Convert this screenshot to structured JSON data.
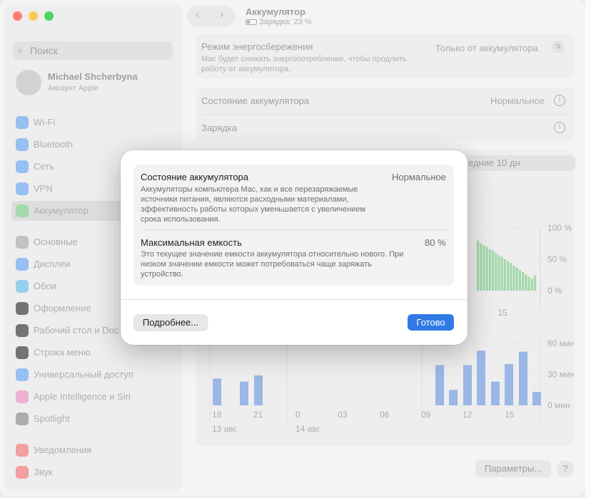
{
  "colors": {
    "accent": "#2f7ae5",
    "bar_green": "#8fd19a",
    "bar_blue": "#86a8e0",
    "traffic_red": "#ff5f57",
    "traffic_yellow": "#febc2e",
    "traffic_green": "#28c840"
  },
  "sidebar": {
    "search_placeholder": "Поиск",
    "account": {
      "name": "Michael Shcherbyna",
      "sub": "Аккаунт Apple"
    },
    "items": [
      {
        "label": "Wi-Fi",
        "icon": "wifi-icon",
        "color": "#7fb2f0"
      },
      {
        "label": "Bluetooth",
        "icon": "bluetooth-icon",
        "color": "#7fb2f0"
      },
      {
        "label": "Сеть",
        "icon": "globe-icon",
        "color": "#7fb2f0"
      },
      {
        "label": "VPN",
        "icon": "vpn-icon",
        "color": "#7fb2f0"
      },
      {
        "label": "Аккумулятор",
        "icon": "battery-icon",
        "color": "#8fd19a"
      },
      {
        "label": "Основные",
        "icon": "gear-icon",
        "color": "#b5b5b5"
      },
      {
        "label": "Дисплеи",
        "icon": "display-icon",
        "color": "#7fb2f0"
      },
      {
        "label": "Обои",
        "icon": "wallpaper-icon",
        "color": "#7fc6e8"
      },
      {
        "label": "Оформление",
        "icon": "appearance-icon",
        "color": "#555555"
      },
      {
        "label": "Рабочий стол и Doc",
        "icon": "desktop-dock-icon",
        "color": "#555555"
      },
      {
        "label": "Строка меню",
        "icon": "menubar-icon",
        "color": "#555555"
      },
      {
        "label": "Универсальный доступ",
        "icon": "accessibility-icon",
        "color": "#7fb2f0"
      },
      {
        "label": "Apple Intelligence и Siri",
        "icon": "siri-icon",
        "color": "#e9a0c8"
      },
      {
        "label": "Spotlight",
        "icon": "spotlight-icon",
        "color": "#9a9a9a"
      },
      {
        "label": "Уведомления",
        "icon": "bell-icon",
        "color": "#f08a8a"
      },
      {
        "label": "Звук",
        "icon": "speaker-icon",
        "color": "#f08a8a"
      }
    ]
  },
  "header": {
    "title": "Аккумулятор",
    "subtitle": "Зарядка: 23 %"
  },
  "settings": {
    "power_mode": {
      "title": "Режим энергосбережения",
      "desc": "Mac будет снижать энергопотребление, чтобы продлить работу от аккумулятора.",
      "value": "Только от аккумулятора"
    },
    "battery_state": {
      "title": "Состояние аккумулятора",
      "value": "Нормальное"
    },
    "charging": {
      "title": "Зарядка"
    }
  },
  "segment": {
    "label": "едние 10 дн"
  },
  "chart_data": [
    {
      "type": "bar",
      "y_ticks": [
        "100 %",
        "50 %",
        "0 %"
      ],
      "x_tick": "15",
      "values": [
        80,
        75,
        72,
        70,
        66,
        64,
        60,
        57,
        54,
        50,
        47,
        44,
        40,
        37,
        33,
        30,
        26,
        22,
        19,
        24
      ],
      "ylim": [
        0,
        100
      ]
    },
    {
      "type": "bar",
      "x_ticks": [
        "18",
        "21",
        "0",
        "03",
        "06",
        "09",
        "12",
        "15"
      ],
      "date_labels": [
        "13 авг.",
        "14 авг."
      ],
      "y_ticks": [
        "60 мин",
        "30 мин",
        "0 мин"
      ],
      "values_left": [
        26,
        23,
        29
      ],
      "values_right": [
        39,
        15,
        39,
        53,
        23,
        40,
        52,
        13
      ],
      "ylim": [
        0,
        60
      ]
    }
  ],
  "buttons": {
    "params": "Параметры...",
    "help": "?"
  },
  "dialog": {
    "state_title": "Состояние аккумулятора",
    "state_value": "Нормальное",
    "state_desc": "Аккумуляторы компьютера Mac, как и все перезаряжаемые источники питания, являются расходными материалами, эффективность работы которых уменьшается с увеличением срока использования.",
    "cap_title": "Максимальная емкость",
    "cap_value": "80 %",
    "cap_desc": "Это текущее значение емкости аккумулятора относительно нового. При низком значении емкости может потребоваться чаще заряжать устройство.",
    "more_button": "Подробнее...",
    "done_button": "Готово"
  }
}
